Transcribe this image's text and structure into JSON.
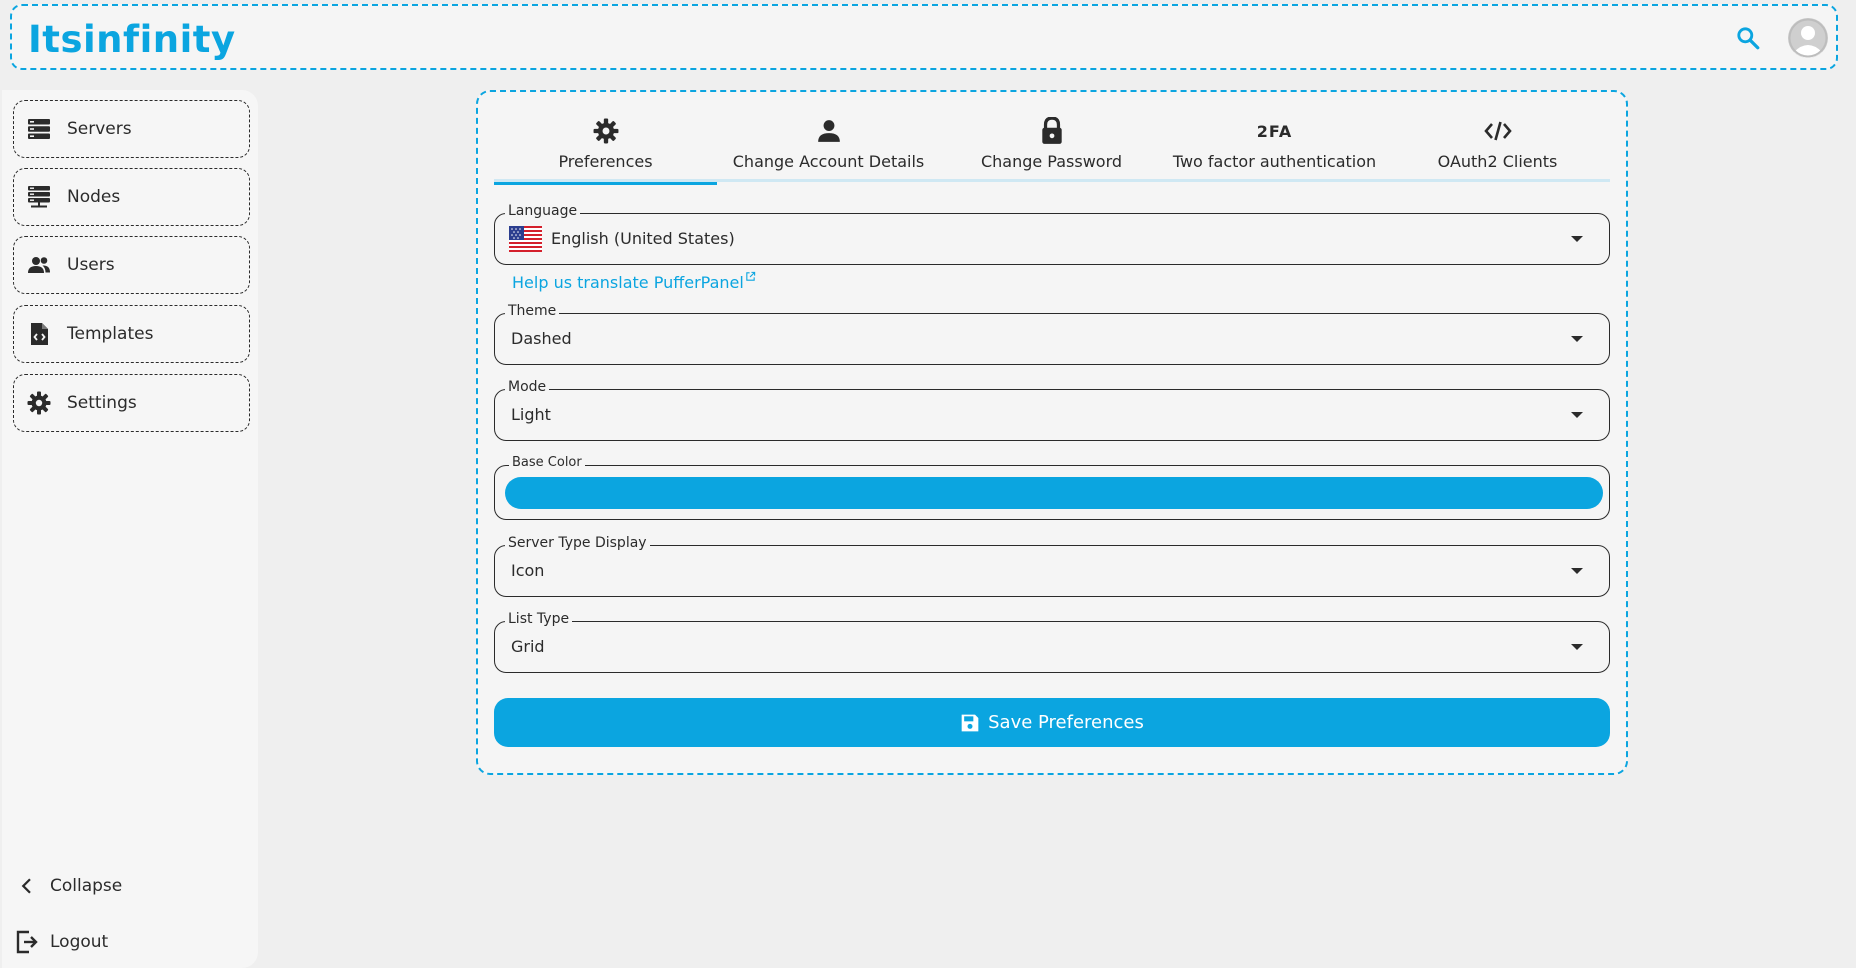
{
  "header": {
    "logo": "Itsinfinity"
  },
  "sidebar": {
    "items": [
      {
        "label": "Servers",
        "icon": "servers-icon"
      },
      {
        "label": "Nodes",
        "icon": "nodes-icon"
      },
      {
        "label": "Users",
        "icon": "users-icon"
      },
      {
        "label": "Templates",
        "icon": "templates-icon"
      },
      {
        "label": "Settings",
        "icon": "settings-icon"
      }
    ],
    "collapse_label": "Collapse",
    "logout_label": "Logout"
  },
  "tabs": [
    {
      "label": "Preferences",
      "icon": "gear-icon",
      "active": true
    },
    {
      "label": "Change Account Details",
      "icon": "person-icon",
      "active": false
    },
    {
      "label": "Change Password",
      "icon": "lock-icon",
      "active": false
    },
    {
      "label": "Two factor authentication",
      "icon_text": "2FA",
      "active": false
    },
    {
      "label": "OAuth2 Clients",
      "icon": "code-icon",
      "active": false
    }
  ],
  "form": {
    "language": {
      "label": "Language",
      "value": "English (United States)"
    },
    "help_link": "Help us translate PufferPanel",
    "theme": {
      "label": "Theme",
      "value": "Dashed"
    },
    "mode": {
      "label": "Mode",
      "value": "Light"
    },
    "base_color": {
      "label": "Base Color",
      "value": "#0ba5e0"
    },
    "server_type_display": {
      "label": "Server Type Display",
      "value": "Icon"
    },
    "list_type": {
      "label": "List Type",
      "value": "Grid"
    },
    "save_label": "Save Preferences"
  },
  "colors": {
    "accent": "#0ba5e0",
    "text": "#2b2b2b",
    "background": "#efefef"
  }
}
